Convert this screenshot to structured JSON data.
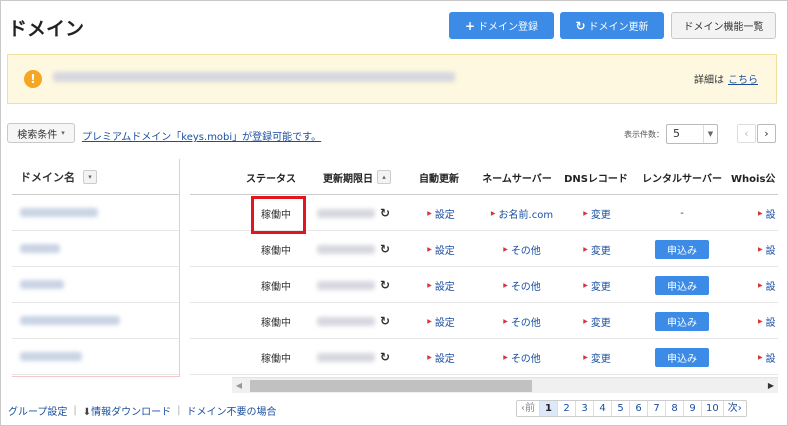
{
  "page": {
    "title": "ドメイン"
  },
  "header": {
    "register_label": "ドメイン登録",
    "update_label": "ドメイン更新",
    "features_label": "ドメイン機能一覧"
  },
  "notice": {
    "detail_text": "詳細は",
    "detail_link": "こちら"
  },
  "filter": {
    "label": "検索条件",
    "promo_text": "プレミアムドメイン「keys.mobi」が登録可能です。",
    "per_page_label": "表示件数：",
    "per_page_value": "5"
  },
  "table": {
    "headers": {
      "domain": "ドメイン名",
      "status": "ステータス",
      "expiry": "更新期限日",
      "autorenew": "自動更新",
      "nameserver": "ネームサーバー",
      "dns": "DNSレコード",
      "rental": "レンタルサーバー",
      "whois": "Whois公"
    },
    "rows": [
      {
        "status": "稼働中",
        "autorenew": "設定",
        "nameserver": "お名前.com",
        "dns": "変更",
        "rental": "-",
        "whois": "設"
      },
      {
        "status": "稼働中",
        "autorenew": "設定",
        "nameserver": "その他",
        "dns": "変更",
        "rental": "申込み",
        "whois": "設"
      },
      {
        "status": "稼働中",
        "autorenew": "設定",
        "nameserver": "その他",
        "dns": "変更",
        "rental": "申込み",
        "whois": "設"
      },
      {
        "status": "稼働中",
        "autorenew": "設定",
        "nameserver": "その他",
        "dns": "変更",
        "rental": "申込み",
        "whois": "設"
      },
      {
        "status": "稼働中",
        "autorenew": "設定",
        "nameserver": "その他",
        "dns": "変更",
        "rental": "申込み",
        "whois": "設"
      }
    ]
  },
  "footer": {
    "group_label": "グループ設定",
    "download_label": "情報ダウンロード",
    "unneeded_label": "ドメイン不要の場合"
  },
  "pagination": {
    "prev": "‹前",
    "pages": [
      "1",
      "2",
      "3",
      "4",
      "5",
      "6",
      "7",
      "8",
      "9",
      "10"
    ],
    "current": "1",
    "next": "次›"
  },
  "colors": {
    "accent": "#3c8ce7",
    "highlight": "#e3151e",
    "notice_bg": "#fdf8df",
    "link": "#1a4fa0"
  },
  "icons": {
    "register": "plus-icon",
    "update": "refresh-icon",
    "notice": "warning-icon",
    "download": "download-icon"
  }
}
